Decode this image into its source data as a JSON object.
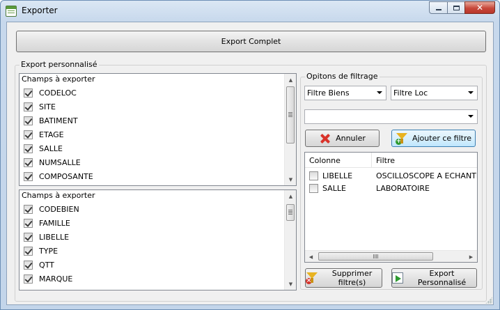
{
  "window": {
    "title": "Exporter",
    "controls": {
      "close_glyph": "✕"
    }
  },
  "main": {
    "export_complet_label": "Export Complet",
    "group_label": "Export personnalisé"
  },
  "list1": {
    "header": "Champs à exporter",
    "items": [
      {
        "label": "CODELOC",
        "checked": true
      },
      {
        "label": "SITE",
        "checked": true
      },
      {
        "label": "BATIMENT",
        "checked": true
      },
      {
        "label": "ETAGE",
        "checked": true
      },
      {
        "label": "SALLE",
        "checked": true
      },
      {
        "label": "NUMSALLE",
        "checked": true
      },
      {
        "label": "COMPOSANTE",
        "checked": true
      }
    ]
  },
  "list2": {
    "header": "Champs à exporter",
    "items": [
      {
        "label": "CODEBIEN",
        "checked": true
      },
      {
        "label": "FAMILLE",
        "checked": true
      },
      {
        "label": "LIBELLE",
        "checked": true
      },
      {
        "label": "TYPE",
        "checked": true
      },
      {
        "label": "QTT",
        "checked": true
      },
      {
        "label": "MARQUE",
        "checked": true
      }
    ]
  },
  "filter": {
    "group_label": "Opitons de filtrage",
    "combo1_value": "Filtre Biens",
    "combo2_value": "Filtre Loc",
    "combo3_value": "",
    "annuler_label": "Annuler",
    "ajouter_label": "Ajouter ce filtre",
    "table": {
      "columns": [
        "Colonne",
        "Filtre"
      ],
      "rows": [
        {
          "colonne": "LIBELLE",
          "filtre": "OSCILLOSCOPE A ECHANTII",
          "checked": false
        },
        {
          "colonne": "SALLE",
          "filtre": "LABORATOIRE",
          "checked": false
        }
      ],
      "hscroll_left": "◀",
      "hscroll_right": "▶"
    },
    "supprimer_label": "Supprimer filtre(s)",
    "export_perso_label": "Export Personnalisé"
  },
  "icons": {
    "app": "app-icon",
    "annuler": "x-icon",
    "ajouter": "funnel-add-icon",
    "supprimer": "funnel-remove-icon",
    "export_perso": "export-icon"
  },
  "colors": {
    "titlebar": "#c7d8ec",
    "close_button": "#c7483a",
    "highlight_button": "#bee6fd"
  }
}
